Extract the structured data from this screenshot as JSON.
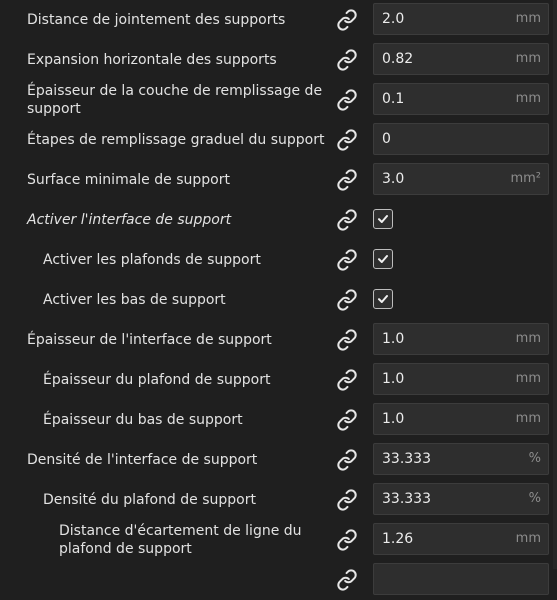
{
  "settings": [
    {
      "label": "Distance de jointement des supports",
      "control": "field",
      "value": "2.0",
      "unit": "mm",
      "indent": 0,
      "italic": false
    },
    {
      "label": "Expansion horizontale des supports",
      "control": "field",
      "value": "0.82",
      "unit": "mm",
      "indent": 0,
      "italic": false
    },
    {
      "label": "Épaisseur de la couche de remplissage de support",
      "control": "field",
      "value": "0.1",
      "unit": "mm",
      "indent": 0,
      "italic": false
    },
    {
      "label": "Étapes de remplissage graduel du support",
      "control": "field",
      "value": "0",
      "unit": "",
      "indent": 0,
      "italic": false
    },
    {
      "label": "Surface minimale de support",
      "control": "field",
      "value": "3.0",
      "unit": "mm²",
      "indent": 0,
      "italic": false
    },
    {
      "label": "Activer l'interface de support",
      "control": "checkbox",
      "checked": true,
      "indent": 0,
      "italic": true
    },
    {
      "label": "Activer les plafonds de support",
      "control": "checkbox",
      "checked": true,
      "indent": 1,
      "italic": false
    },
    {
      "label": "Activer les bas de support",
      "control": "checkbox",
      "checked": true,
      "indent": 1,
      "italic": false
    },
    {
      "label": "Épaisseur de l'interface de support",
      "control": "field",
      "value": "1.0",
      "unit": "mm",
      "indent": 0,
      "italic": false
    },
    {
      "label": "Épaisseur du plafond de support",
      "control": "field",
      "value": "1.0",
      "unit": "mm",
      "indent": 1,
      "italic": false
    },
    {
      "label": "Épaisseur du bas de support",
      "control": "field",
      "value": "1.0",
      "unit": "mm",
      "indent": 1,
      "italic": false
    },
    {
      "label": "Densité de l'interface de support",
      "control": "field",
      "value": "33.333",
      "unit": "%",
      "indent": 0,
      "italic": false
    },
    {
      "label": "Densité du plafond de support",
      "control": "field",
      "value": "33.333",
      "unit": "%",
      "indent": 1,
      "italic": false
    },
    {
      "label": "Distance d'écartement de ligne du plafond de support",
      "control": "field",
      "value": "1.26",
      "unit": "mm",
      "indent": 2,
      "italic": false
    },
    {
      "label": "",
      "control": "field",
      "value": "",
      "unit": "",
      "indent": 2,
      "italic": false
    }
  ],
  "icons": {
    "link": "link-icon",
    "check": "checkmark-icon"
  },
  "colors": {
    "background": "#1f1f1f",
    "field": "#2e2e2e",
    "text": "#e2e2e2",
    "unit": "#8c8c8c"
  }
}
